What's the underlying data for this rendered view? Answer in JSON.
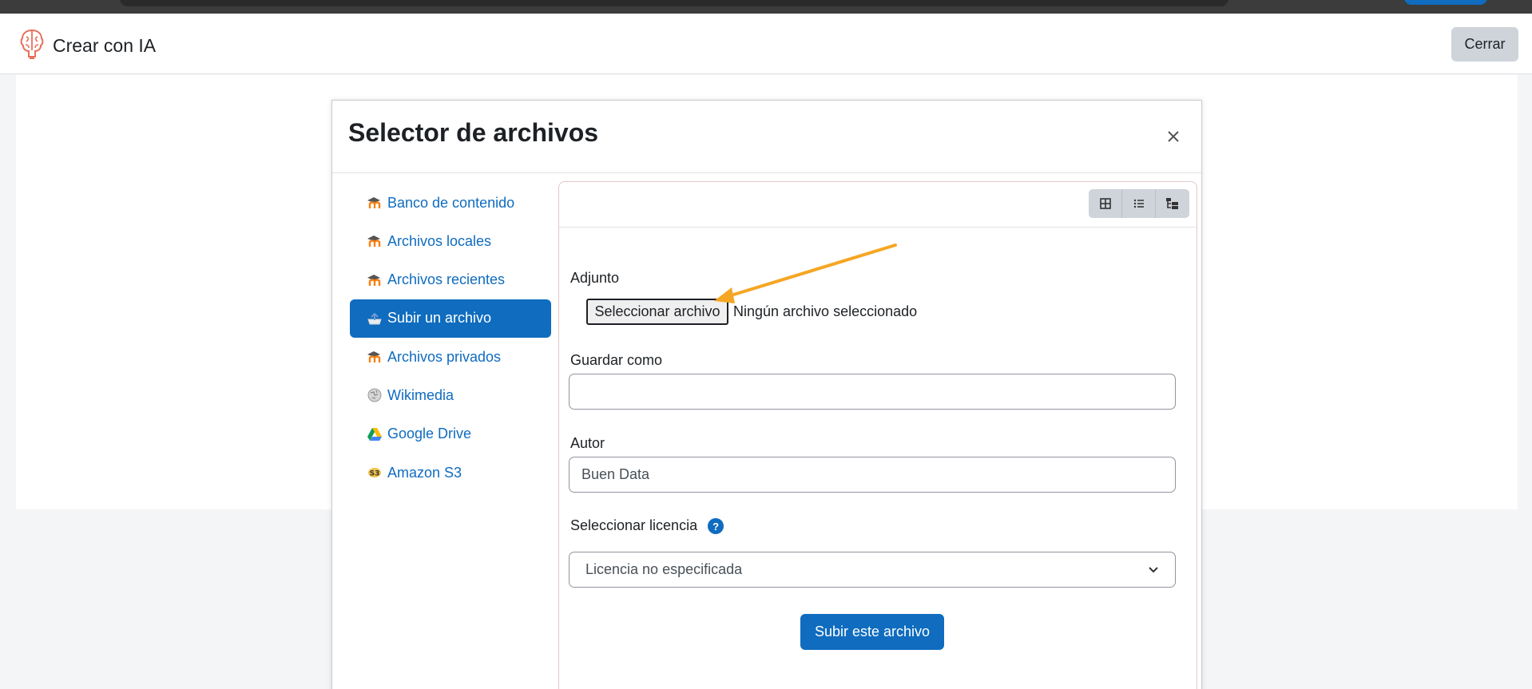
{
  "header": {
    "title": "Crear con IA",
    "close_label": "Cerrar"
  },
  "modal": {
    "title": "Selector de archivos",
    "nav": [
      {
        "label": "Banco de contenido",
        "icon": "moodle-icon"
      },
      {
        "label": "Archivos locales",
        "icon": "moodle-icon"
      },
      {
        "label": "Archivos recientes",
        "icon": "moodle-icon"
      },
      {
        "label": "Subir un archivo",
        "icon": "upload-icon",
        "active": true
      },
      {
        "label": "Archivos privados",
        "icon": "moodle-icon"
      },
      {
        "label": "Wikimedia",
        "icon": "wikimedia-icon"
      },
      {
        "label": "Google Drive",
        "icon": "google-drive-icon"
      },
      {
        "label": "Amazon S3",
        "icon": "amazon-s3-icon"
      }
    ],
    "form": {
      "attachment_label": "Adjunto",
      "choose_file_label": "Seleccionar archivo",
      "no_file_text": "Ningún archivo seleccionado",
      "save_as_label": "Guardar como",
      "save_as_value": "",
      "author_label": "Autor",
      "author_value": "Buen Data",
      "license_label": "Seleccionar licencia",
      "license_value": "Licencia no especificada",
      "submit_label": "Subir este archivo"
    }
  },
  "colors": {
    "primary": "#0f6cbf",
    "brand_icon": "#e8705a",
    "annotation_arrow": "#f5a623"
  }
}
